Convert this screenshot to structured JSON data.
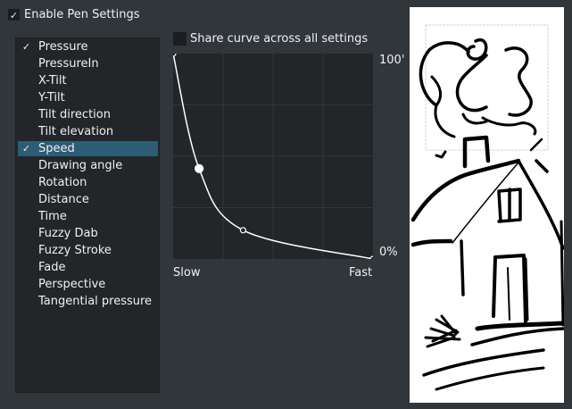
{
  "enable_pen_settings": {
    "label": "Enable Pen Settings",
    "checked": true,
    "check_glyph": "✓"
  },
  "sensors": [
    {
      "label": "Pressure",
      "checked": true,
      "selected": false
    },
    {
      "label": "PressureIn",
      "checked": false,
      "selected": false
    },
    {
      "label": "X-Tilt",
      "checked": false,
      "selected": false
    },
    {
      "label": "Y-Tilt",
      "checked": false,
      "selected": false
    },
    {
      "label": "Tilt direction",
      "checked": false,
      "selected": false
    },
    {
      "label": "Tilt elevation",
      "checked": false,
      "selected": false
    },
    {
      "label": "Speed",
      "checked": true,
      "selected": true
    },
    {
      "label": "Drawing angle",
      "checked": false,
      "selected": false
    },
    {
      "label": "Rotation",
      "checked": false,
      "selected": false
    },
    {
      "label": "Distance",
      "checked": false,
      "selected": false
    },
    {
      "label": "Time",
      "checked": false,
      "selected": false
    },
    {
      "label": "Fuzzy Dab",
      "checked": false,
      "selected": false
    },
    {
      "label": "Fuzzy Stroke",
      "checked": false,
      "selected": false
    },
    {
      "label": "Fade",
      "checked": false,
      "selected": false
    },
    {
      "label": "Perspective",
      "checked": false,
      "selected": false
    },
    {
      "label": "Tangential pressure",
      "checked": false,
      "selected": false
    }
  ],
  "share_curve": {
    "label": "Share curve across all settings",
    "checked": false
  },
  "curve": {
    "x_min_label": "Slow",
    "x_max_label": "Fast",
    "y_max_label": "100'",
    "y_min_label": "0%",
    "control_points": [
      {
        "x": 0.0,
        "y": 1.0
      },
      {
        "x": 0.13,
        "y": 0.44
      },
      {
        "x": 0.35,
        "y": 0.14
      },
      {
        "x": 1.0,
        "y": 0.0
      }
    ],
    "selected_point_index": 1,
    "colors": {
      "background": "#232629",
      "grid": "#31363b",
      "curve": "#ffffff"
    }
  },
  "preview": {
    "background": "#ffffff",
    "stroke_color": "#000000"
  }
}
